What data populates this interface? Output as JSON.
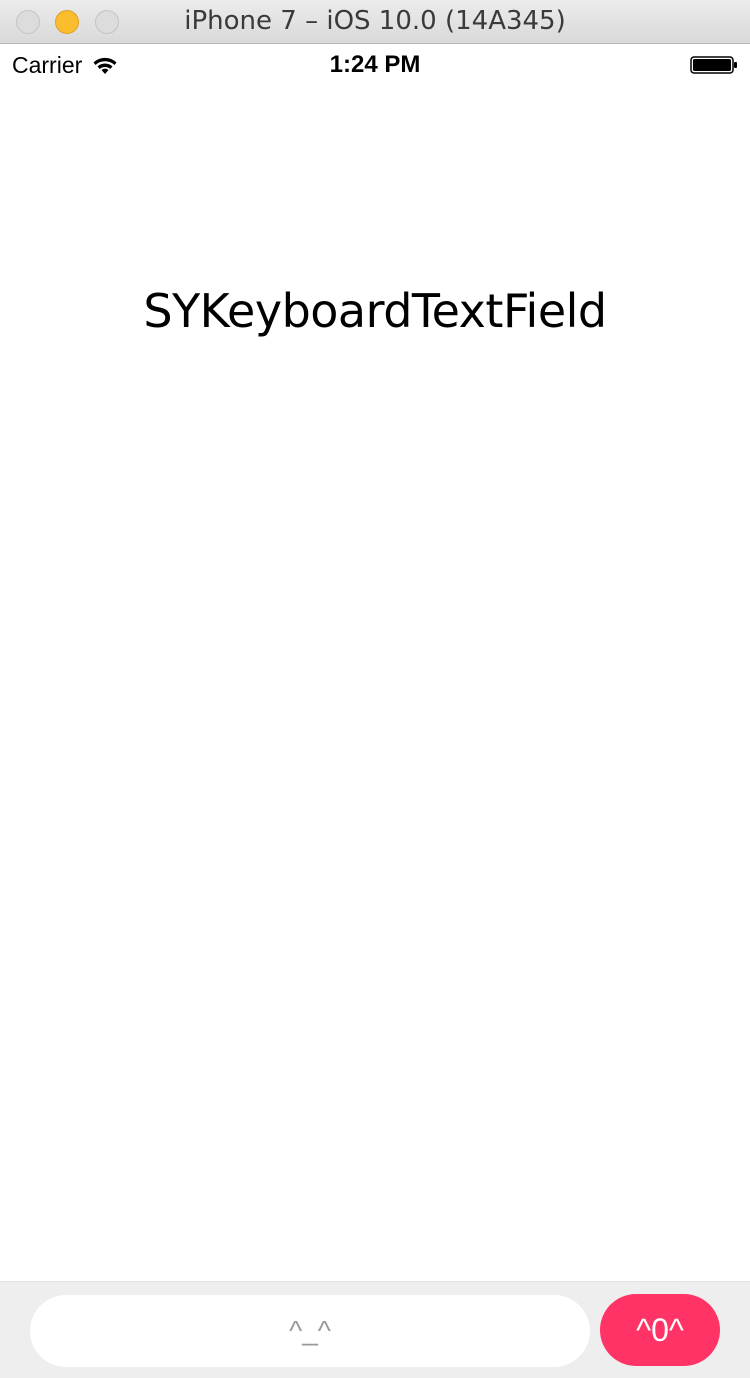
{
  "window": {
    "title": "iPhone 7 – iOS 10.0 (14A345)"
  },
  "status_bar": {
    "carrier": "Carrier",
    "time": "1:24 PM"
  },
  "main": {
    "title": "SYKeyboardTextField"
  },
  "input_bar": {
    "placeholder": "^_^",
    "send_label": "^0^"
  },
  "colors": {
    "accent": "#ff3366",
    "minimize": "#f9bd2e",
    "input_bar_bg": "#eeeeee"
  },
  "icons": [
    "wifi-icon",
    "battery-icon"
  ]
}
